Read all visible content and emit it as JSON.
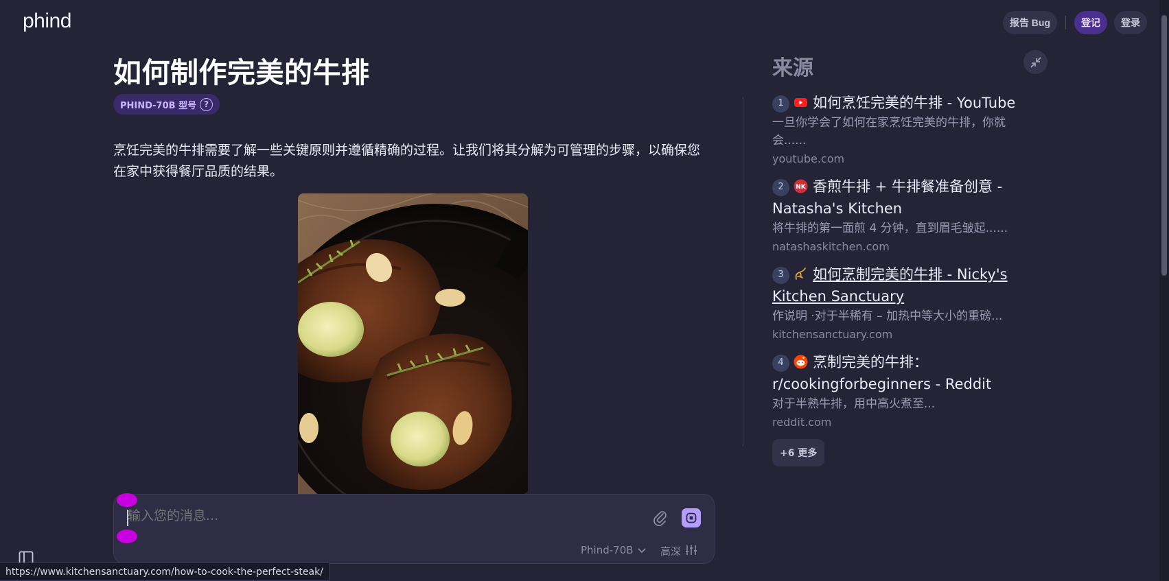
{
  "header": {
    "logo": "phind",
    "report_bug": "报告 Bug",
    "signup": "登记",
    "login": "登录"
  },
  "main": {
    "title": "如何制作完美的牛排",
    "model_badge": "PHIND-70B 型号",
    "intro": "烹饪完美的牛排需要了解一些关键原则并遵循精确的过程。让我们将其分解为可管理的步骤，以确保您在家中获得餐厅品质的结果。"
  },
  "composer": {
    "placeholder": "输入您的消息...",
    "model": "Phind-70B",
    "depth": "高深"
  },
  "sources": {
    "title": "来源",
    "items": [
      {
        "num": "1",
        "title": "如何烹饪完美的牛排 - YouTube",
        "snippet": "一旦你学会了如何在家烹饪完美的牛排，你就会......",
        "domain": "youtube.com",
        "icon": "youtube-icon"
      },
      {
        "num": "2",
        "title": "香煎牛排 + 牛排餐准备创意 - Natasha's Kitchen",
        "snippet": "将牛排的第一面煎 4 分钟，直到眉毛皱起......",
        "domain": "natashaskitchen.com",
        "icon": "natasha-icon",
        "icon_text": "NK"
      },
      {
        "num": "3",
        "title": "如何烹制完美的牛排 - Nicky's Kitchen Sanctuary",
        "snippet": "作说明 ·对于半稀有 – 加热中等大小的重磅...",
        "domain": "kitchensanctuary.com",
        "icon": "kitchensanctuary-icon"
      },
      {
        "num": "4",
        "title": "烹制完美的牛排：r/cookingforbeginners - Reddit",
        "snippet": "对于半熟牛排，用中高火煮至...",
        "domain": "reddit.com",
        "icon": "reddit-icon"
      }
    ],
    "more": "+6 更多"
  },
  "status_url": "https://www.kitchensanctuary.com/how-to-cook-the-perfect-steak/",
  "colors": {
    "background": "#252437",
    "accent": "#b49dff",
    "badge": "#3b2a6a"
  }
}
